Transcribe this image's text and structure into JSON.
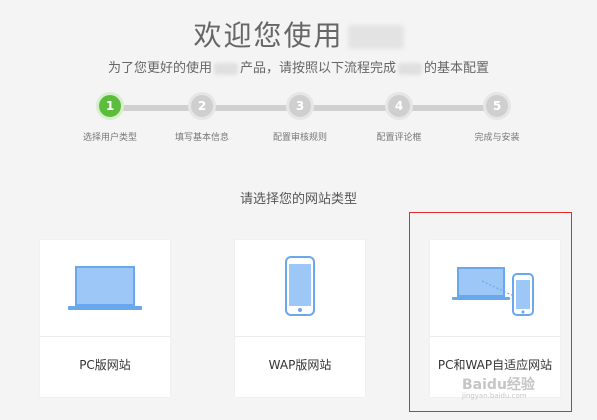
{
  "header": {
    "title": "欢迎您使用",
    "subtitle_parts": [
      "为了您更好的使用",
      "产品，请按照以下流程完成",
      "的基本配置"
    ]
  },
  "steps": [
    {
      "number": "1",
      "label": "选择用户类型",
      "active": true
    },
    {
      "number": "2",
      "label": "填写基本信息",
      "active": false
    },
    {
      "number": "3",
      "label": "配置审核规则",
      "active": false
    },
    {
      "number": "4",
      "label": "配置评论框",
      "active": false
    },
    {
      "number": "5",
      "label": "完成与安装",
      "active": false
    }
  ],
  "section": {
    "title": "请选择您的网站类型"
  },
  "cards": [
    {
      "label": "PC版网站",
      "icon": "laptop-icon"
    },
    {
      "label": "WAP版网站",
      "icon": "phone-icon"
    },
    {
      "label": "PC和WAP自适应网站",
      "icon": "laptop-phone-icon"
    }
  ],
  "colors": {
    "active_step": "#5bbd3b",
    "inactive_step": "#cfcfcf",
    "device_screen": "#9cc7f6",
    "device_frame": "#6aa8ee",
    "highlight": "#e02b2b"
  },
  "watermark": {
    "main": "Baidu经验",
    "sub": "jingyan.baidu.com"
  }
}
